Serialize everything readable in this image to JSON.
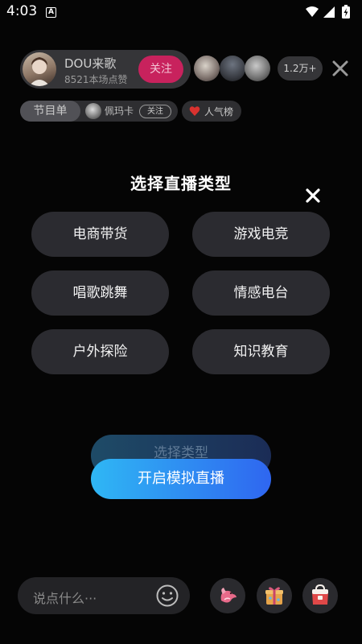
{
  "status_bar": {
    "time": "4:03",
    "notification_icon": "a-letter-icon",
    "icons": [
      "wifi-icon",
      "signal-icon",
      "battery-charging-icon"
    ]
  },
  "host": {
    "name": "DOU来歌",
    "likes": "8521本场点赞",
    "follow_label": "关注"
  },
  "viewers": {
    "count": "1.2万+"
  },
  "program": {
    "label": "节目单",
    "singer": "佩玛卡",
    "follow_label": "关注"
  },
  "ranking": {
    "label": "人气榜",
    "icon": "heart-icon"
  },
  "modal": {
    "title": "选择直播类型",
    "types": [
      "电商带货",
      "游戏电竞",
      "唱歌跳舞",
      "情感电台",
      "户外探险",
      "知识教育"
    ],
    "ghost_label": "选择类型",
    "start_label": "开启模拟直播"
  },
  "bottom_bar": {
    "comment_placeholder": "说点什么···",
    "buttons": [
      "gift-bird-icon",
      "gift-box-icon",
      "shop-bag-icon"
    ]
  },
  "colors": {
    "background": "#050505",
    "follow_button": "#c8225d",
    "start_gradient_start": "#2fb7f4",
    "start_gradient_end": "#2f66f0",
    "type_button": "#2b2b30"
  }
}
